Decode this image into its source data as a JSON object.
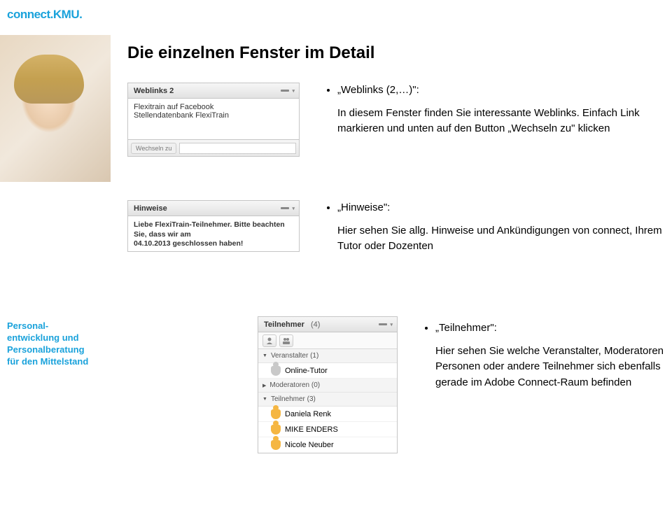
{
  "logo": {
    "part1": "connect.",
    "part2": "KMU",
    "dot": "."
  },
  "sidebar_text": {
    "l1": "Personal-",
    "l2": "entwicklung und",
    "l3": "Personalberatung",
    "l4": "für den Mittelstand"
  },
  "heading": "Die einzelnen Fenster im Detail",
  "weblinks_panel": {
    "title": "Weblinks 2",
    "item1": "Flexitrain auf Facebook",
    "item2": "Stellendatenbank FlexiTrain",
    "btn": "Wechseln zu"
  },
  "hinweise_panel": {
    "title": "Hinweise",
    "msg1": "Liebe FlexiTrain-Teilnehmer. Bitte beachten Sie, dass wir am",
    "msg2": "04.10.2013 geschlossen haben!"
  },
  "teilnehmer_panel": {
    "title": "Teilnehmer",
    "count": "(4)",
    "grp_veranstalter": "Veranstalter (1)",
    "row_tutor": "Online-Tutor",
    "grp_moderatoren": "Moderatoren (0)",
    "grp_teilnehmer": "Teilnehmer (3)",
    "tn1": "Daniela Renk",
    "tn2": "MIKE ENDERS",
    "tn3": "Nicole Neuber",
    "tri_down": "▼",
    "tri_right": "▶"
  },
  "bullets": {
    "weblinks": {
      "t": "„Weblinks (2,…)\":",
      "d": "In diesem Fenster finden Sie interessante Weblinks. Einfach Link markieren und unten auf den Button „Wechseln zu\" klicken"
    },
    "hinweise": {
      "t": "„Hinweise\":",
      "d": "Hier sehen Sie allg. Hinweise und Ankündigungen von connect, Ihrem Tutor oder Dozenten"
    },
    "teilnehmer": {
      "t": "„Teilnehmer\":",
      "d": "Hier sehen Sie welche Veranstalter, Moderatoren Personen oder andere Teilnehmer sich ebenfalls gerade im Adobe Connect-Raum befinden"
    }
  }
}
